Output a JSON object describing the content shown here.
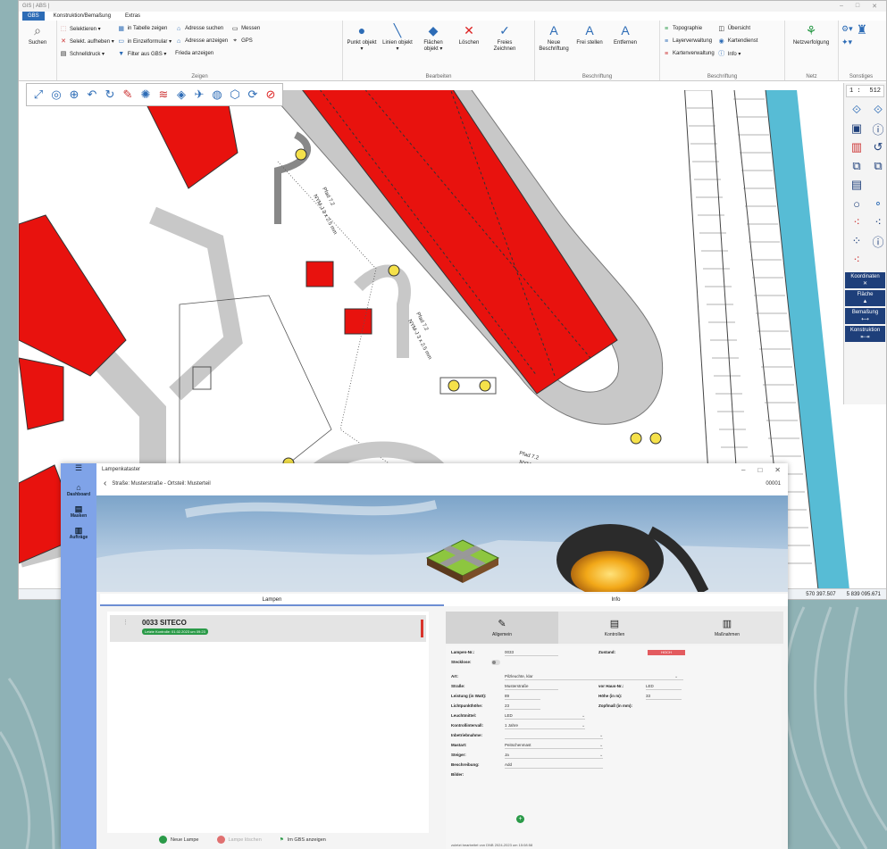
{
  "colors": {
    "ribbon_active": "#2d6cb6",
    "building_red": "#e8120e",
    "road_gray": "#c8c8c8",
    "canal_cyan": "#57bcd5",
    "app_nav": "#7fa3e8",
    "status_red": "#e35b5f",
    "green": "#2a9a48"
  },
  "gis": {
    "title": "GIS | ABS |",
    "menu": [
      "GBS",
      "Konstruktion/Bemaßung",
      "Extras"
    ],
    "ribbon": {
      "suchen": "Suchen",
      "zeigen": {
        "items": [
          "Selektieren ▾",
          "Selekt. aufheben ▾",
          "Schnelldruck ▾",
          "in Tabelle zeigen",
          "in Einzelformular ▾",
          "Filter aus GBS ▾",
          "Adresse suchen",
          "Adresse anzeigen",
          "Frieda anzeigen",
          "Messen",
          "GPS"
        ],
        "label": "Zeigen"
      },
      "bearbeiten": {
        "items": [
          "Punkt objekt ▾",
          "Linien objekt ▾",
          "Flächen objekt ▾",
          "Löschen",
          "Freies Zeichnen"
        ],
        "label": "Bearbeiten"
      },
      "beschriftung": {
        "items": [
          "Neue Beschriftung",
          "Frei stellen",
          "Entfernen"
        ],
        "label": "Beschriftung"
      },
      "beschriftung2": {
        "items": [
          "Topographie",
          "Layerverwaltung",
          "Kartenverwaltung",
          "Übersicht",
          "Kartendienst",
          "Info ▾"
        ],
        "label": "Beschriftung"
      },
      "netz": {
        "items": [
          "Netzverfolgung"
        ],
        "label": "Netz"
      },
      "sonstiges": {
        "label": "Sonstiges"
      }
    },
    "scale_prefix": "1 :",
    "scale_value": "512",
    "side_buttons": [
      "Koordinaten",
      "Fläche",
      "Bemaßung",
      "Konstruktion"
    ],
    "coords": [
      "570 397.507",
      "5 839 095.671"
    ],
    "map_labels": [
      "Pfad 7.2",
      "NYM-J 3 x 2.5 mm",
      "Pfad 7.2",
      "NYM-J 3 x 2.5 mm",
      "Pfad 7.2",
      "NYM-J 3 x 2.5"
    ]
  },
  "app": {
    "title": "Lampenkataster",
    "breadcrumb": "Straße: Musterstraße - Ortsteil: Musterteil",
    "record_id": "00001",
    "nav": [
      {
        "label": "Dashboard",
        "icon": "home-icon"
      },
      {
        "label": "Masken",
        "icon": "form-icon"
      },
      {
        "label": "Aufträge",
        "icon": "clipboard-icon"
      }
    ],
    "tabs": [
      "Lampen",
      "Info"
    ],
    "lamp": {
      "name": "0033  SITECO",
      "badge": "Letzte Kontrolle: 01.02.2023 um 09:23"
    },
    "actions": [
      "Neue Lampe",
      "Lampe löschen",
      "Im GBS anzeigen"
    ],
    "detail_tabs": [
      "Allgemein",
      "Kontrollen",
      "Maßnahmen"
    ],
    "form": {
      "lampen_nr_label": "Lampen-Nr.:",
      "lampen_nr": "0033",
      "zustand_label": "Zustand:",
      "zustand": "HOCH",
      "stecklose_label": "Stecklose:",
      "art_label": "Art:",
      "art": "Pilzleuchte, klar",
      "strasse_label": "Straße:",
      "strasse": "Musterstraße",
      "vor_haus_label": "vor Haus-Nr.:",
      "vor_haus": "LED",
      "leistung_label": "Leistung (in Watt):",
      "leistung": "89",
      "hoehe_label": "Höhe (in m):",
      "hoehe": "33",
      "lichtpunkthoehe_label": "Lichtpunkthöhe:",
      "lichtpunkthoehe": "23",
      "zopfmass_label": "Zopfmaß (in mm):",
      "leuchtmittel_label": "Leuchtmittel:",
      "leuchtmittel": "LED",
      "kontrollintervall_label": "Kontrollintervall:",
      "kontrollintervall": "1 Jahre",
      "inbetriebnahme_label": "Inbetriebnahme:",
      "mastart_label": "Mastart:",
      "mastart": "Peitschenmast",
      "steiger_label": "Steiger:",
      "steiger": "Ja",
      "beschreibung_label": "Beschreibung:",
      "beschreibung": "Add",
      "bilder_label": "Bilder:",
      "footnote": "zuletzt bearbeitet von DNB 2024-2023 um 15:08:58"
    }
  }
}
